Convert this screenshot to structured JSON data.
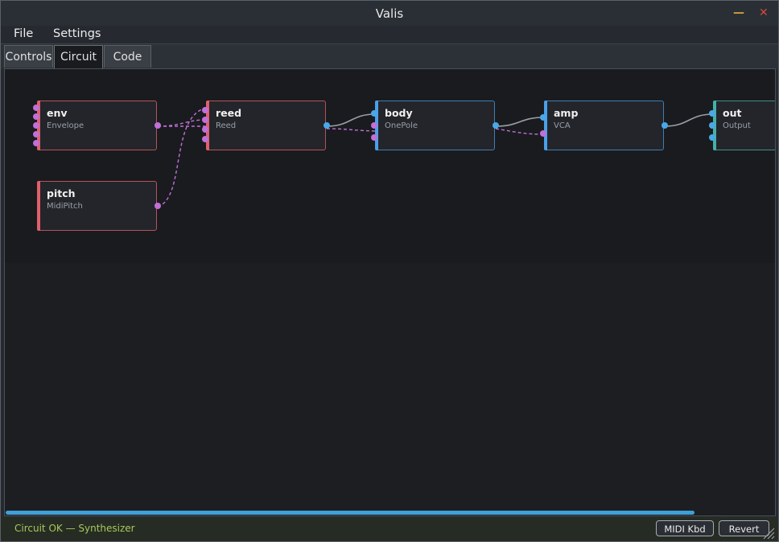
{
  "window": {
    "title": "Valis",
    "minimize_glyph": "—",
    "close_glyph": "✕"
  },
  "menu": {
    "items": [
      "File",
      "Settings"
    ]
  },
  "tabs": [
    {
      "label": "Controls",
      "active": false
    },
    {
      "label": "Circuit",
      "active": true
    },
    {
      "label": "Code",
      "active": false
    }
  ],
  "nodes": [
    {
      "id": "env",
      "title": "env",
      "subtitle": "Envelope",
      "kind": "control"
    },
    {
      "id": "reed",
      "title": "reed",
      "subtitle": "Reed",
      "kind": "control"
    },
    {
      "id": "body",
      "title": "body",
      "subtitle": "OnePole",
      "kind": "audio"
    },
    {
      "id": "amp",
      "title": "amp",
      "subtitle": "VCA",
      "kind": "audio"
    },
    {
      "id": "out",
      "title": "out",
      "subtitle": "Output",
      "kind": "output"
    },
    {
      "id": "pitch",
      "title": "pitch",
      "subtitle": "MidiPitch",
      "kind": "control"
    }
  ],
  "colors": {
    "control_border": "#b5545a",
    "control_bar": "#e0606a",
    "audio_border": "#3e7fb5",
    "audio_bar": "#4aa0e8",
    "output_border": "#3e8e8a",
    "output_bar": "#45b0a8",
    "control_port": "#c070d8",
    "audio_port": "#4aa8e8",
    "audio_wire": "#9aa0a8",
    "control_wire": "#c070d8",
    "status_text": "#a8c85a"
  },
  "status": {
    "text": "Circuit OK  —  Synthesizer"
  },
  "buttons": {
    "midi": "MIDI Kbd",
    "revert": "Revert"
  }
}
